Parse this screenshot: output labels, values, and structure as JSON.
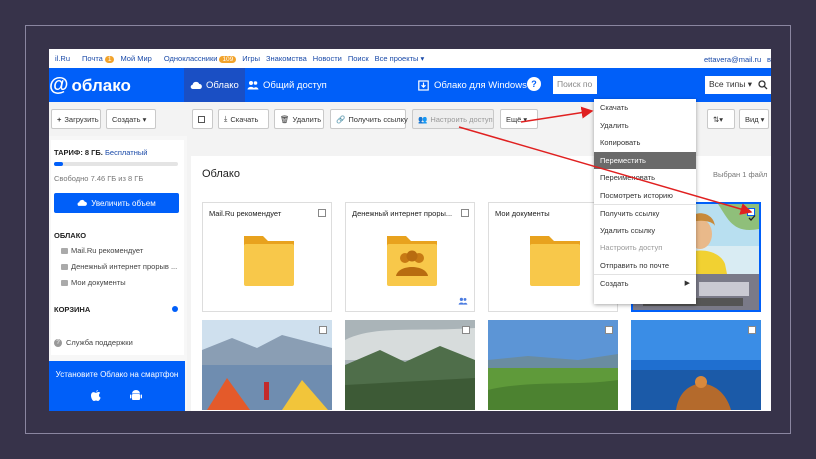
{
  "topnav": {
    "items": [
      "il.Ru",
      "Почта",
      "Мой Мир",
      "Одноклассники",
      "Игры",
      "Знакомства",
      "Новости",
      "Поиск",
      "Все проекты ▾"
    ],
    "mail_badge": "1",
    "ok_badge": "109",
    "email": "ettavera@mail.ru",
    "exit": "вы"
  },
  "header": {
    "logo": "облако",
    "tab_cloud": "Облако",
    "tab_shared": "Общий доступ",
    "windows": "Облако для Windows",
    "help": "?",
    "search_placeholder": "Поиск по",
    "all_types": "Все типы ▾"
  },
  "toolbar": {
    "upload": "Загрузить",
    "create": "Создать ▾",
    "download": "Скачать",
    "delete": "Удалить",
    "get_link": "Получить ссылку",
    "access": "Настроить доступ",
    "more": "Ещё ▾",
    "view": "Вид ▾"
  },
  "sidebar": {
    "tariff_label": "ТАРИФ: 8 ГБ.",
    "tariff_link": "Бесплатный",
    "storage_used_fraction": 0.07,
    "free_text": "Свободно 7.46 ГБ из 8 ГБ",
    "increase": "Увеличить объем",
    "cloud_section": "ОБЛАКО",
    "folders": [
      "Mail.Ru рекомендует",
      "Денежный интернет прорыв ...",
      "Мои документы"
    ],
    "trash": "КОРЗИНА",
    "support": "Служба поддержки",
    "promo": "Установите Облако на смартфон"
  },
  "content": {
    "title": "Облако",
    "selected": "Выбран 1 файл",
    "cards": [
      "Mail.Ru рекомендует",
      "Денежный интернет проры...",
      "Мои документы"
    ]
  },
  "menu": {
    "items": [
      "Скачать",
      "Удалить",
      "Копировать",
      "Переместить",
      "Переименовать",
      "Посмотреть историю",
      "Получить ссылку",
      "Удалить ссылку",
      "Настроить доступ",
      "Отправить по почте",
      "Создать"
    ],
    "highlighted": "Переместить",
    "disabled": "Настроить доступ"
  },
  "colors": {
    "brand": "#005ff9",
    "arrow": "#e02020",
    "folder": "#f8c84a"
  }
}
